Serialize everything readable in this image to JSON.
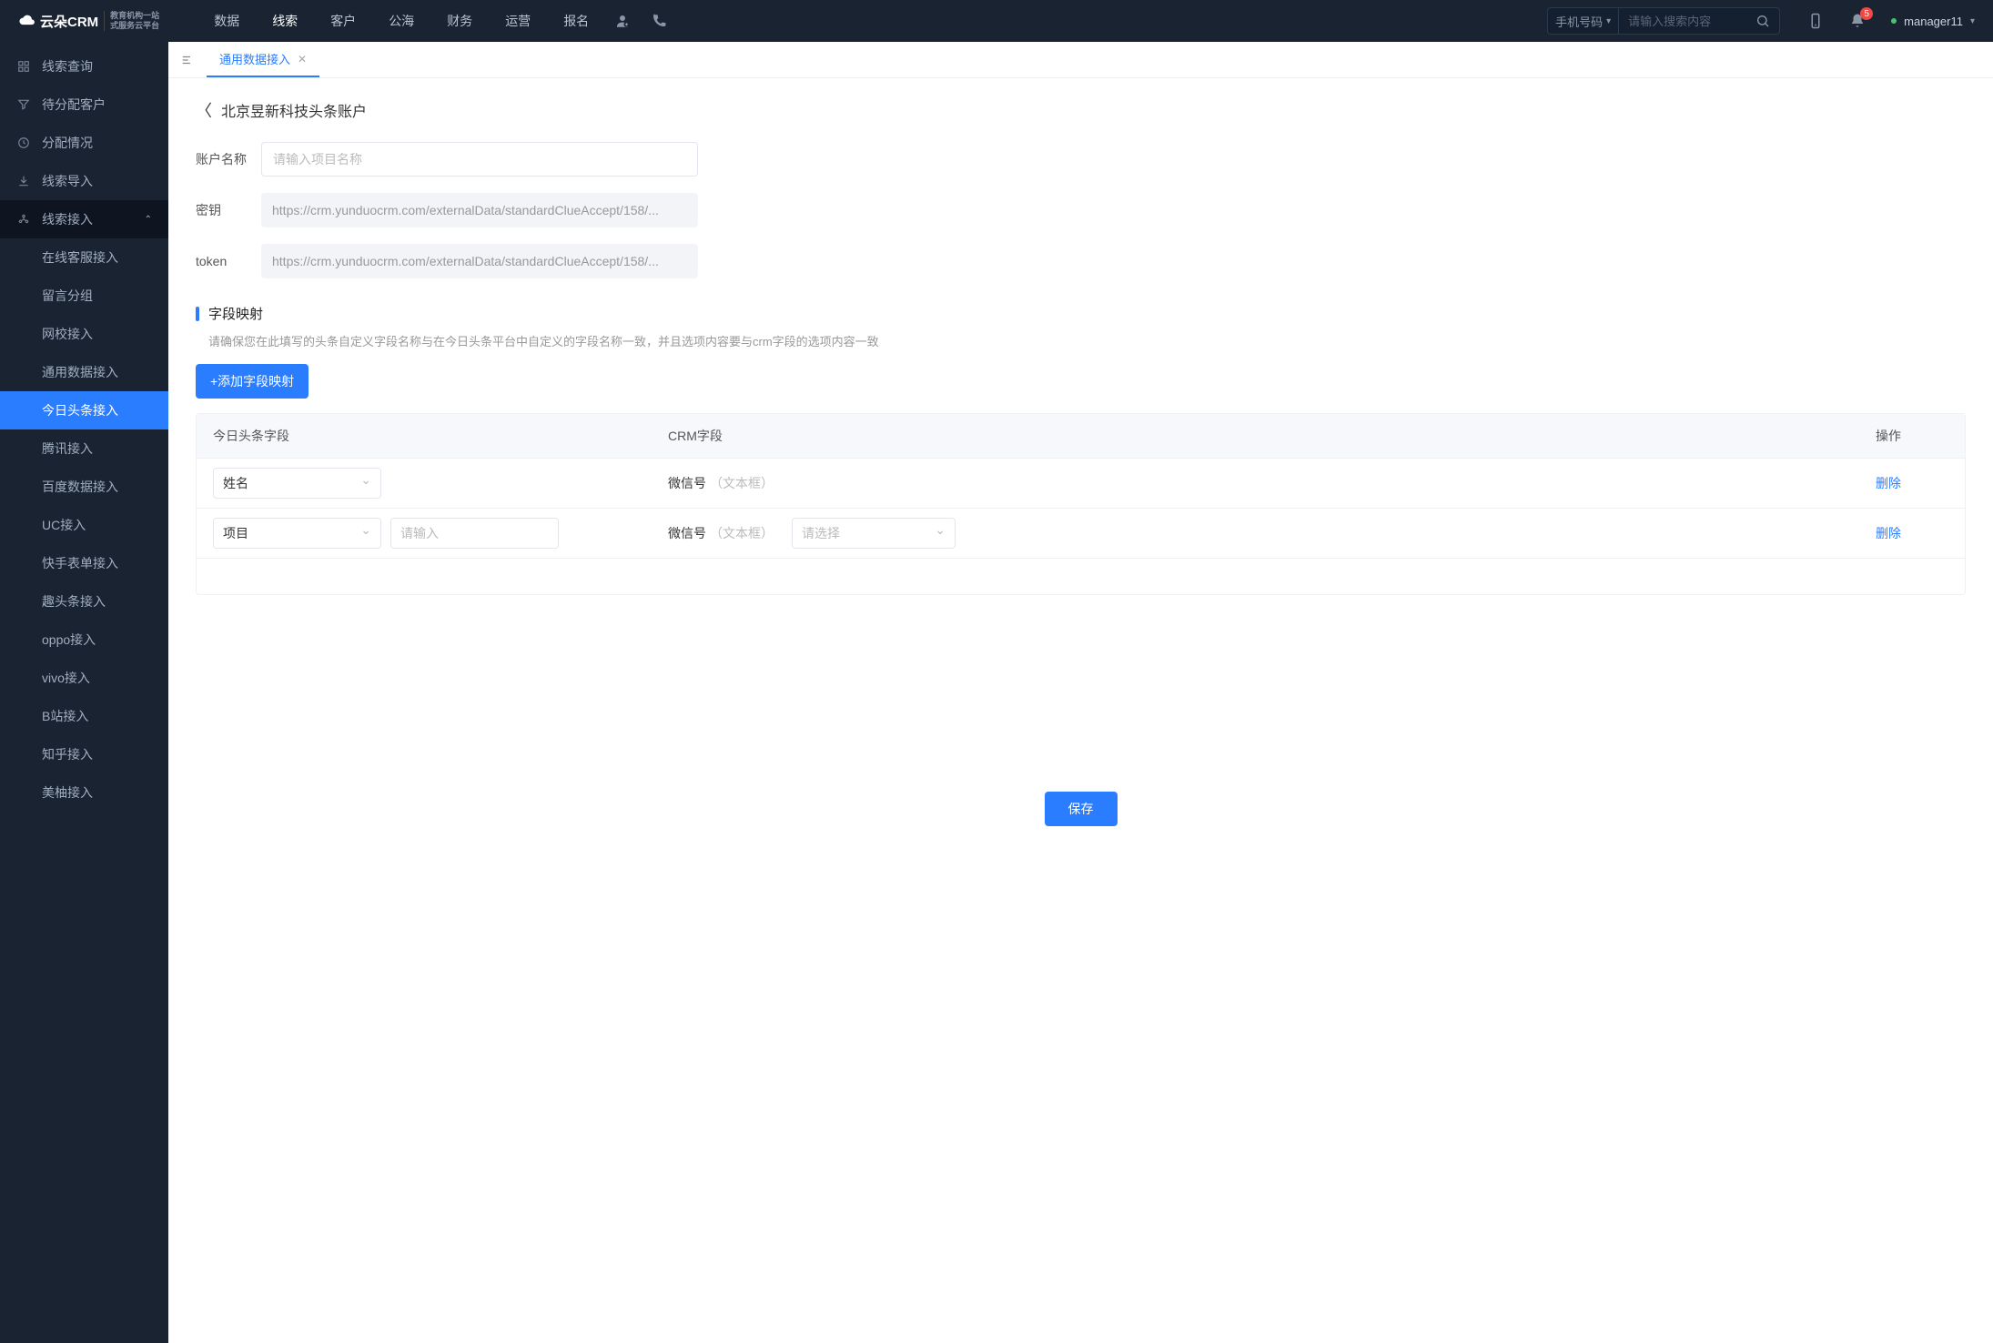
{
  "header": {
    "logo_text": "云朵CRM",
    "logo_sub1": "教育机构一站",
    "logo_sub2": "式服务云平台",
    "nav": [
      "数据",
      "线索",
      "客户",
      "公海",
      "财务",
      "运营",
      "报名"
    ],
    "nav_active": "线索",
    "search_type": "手机号码",
    "search_placeholder": "请输入搜索内容",
    "badge": "5",
    "user": "manager11"
  },
  "sidebar": {
    "items": [
      {
        "label": "线索查询",
        "icon": "grid"
      },
      {
        "label": "待分配客户",
        "icon": "filter"
      },
      {
        "label": "分配情况",
        "icon": "clock"
      },
      {
        "label": "线索导入",
        "icon": "export"
      },
      {
        "label": "线索接入",
        "icon": "plug",
        "expanded": true,
        "children": [
          "在线客服接入",
          "留言分组",
          "网校接入",
          "通用数据接入",
          "今日头条接入",
          "腾讯接入",
          "百度数据接入",
          "UC接入",
          "快手表单接入",
          "趣头条接入",
          "oppo接入",
          "vivo接入",
          "B站接入",
          "知乎接入",
          "美柚接入"
        ],
        "active_child": "今日头条接入"
      }
    ]
  },
  "tabs": {
    "items": [
      {
        "label": "通用数据接入"
      }
    ]
  },
  "page": {
    "title": "北京昱新科技头条账户",
    "form": {
      "account_label": "账户名称",
      "account_placeholder": "请输入项目名称",
      "secret_label": "密钥",
      "secret_value": "https://crm.yunduocrm.com/externalData/standardClueAccept/158/...",
      "token_label": "token",
      "token_value": "https://crm.yunduocrm.com/externalData/standardClueAccept/158/..."
    },
    "section_title": "字段映射",
    "section_desc": "请确保您在此填写的头条自定义字段名称与在今日头条平台中自定义的字段名称一致，并且选项内容要与crm字段的选项内容一致",
    "add_button": "+添加字段映射",
    "table": {
      "headers": [
        "今日头条字段",
        "CRM字段",
        "操作"
      ],
      "rows": [
        {
          "toutiao_select": "姓名",
          "crm_main": "微信号",
          "crm_type": "（文本框）",
          "action": "删除"
        },
        {
          "toutiao_select": "项目",
          "input_placeholder": "请输入",
          "crm_main": "微信号",
          "crm_type": "（文本框）",
          "crm_select_placeholder": "请选择",
          "action": "删除"
        }
      ]
    },
    "save_button": "保存"
  }
}
